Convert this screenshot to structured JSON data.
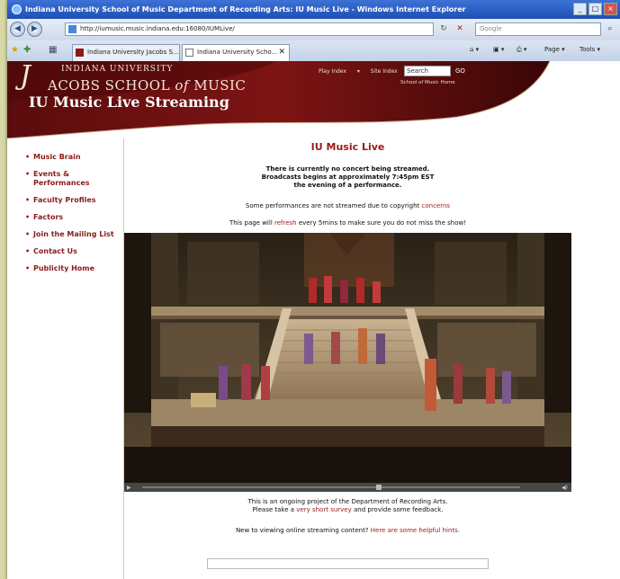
{
  "window": {
    "title": "Indiana University School of Music Department of Recording Arts: IU Music Live - Windows Internet Explorer",
    "url": "http://iumusic.music.indiana.edu:16080/IUMLive/",
    "search_placeholder": "Google"
  },
  "tabs": [
    {
      "label": "Indiana University Jacobs S..."
    },
    {
      "label": "Indiana University Scho..."
    }
  ],
  "commands": {
    "page": "Page",
    "tools": "Tools"
  },
  "banner": {
    "indiana": "INDIANA UNIVERSITY",
    "j": "J",
    "school_pre": "ACOBS SCHOOL ",
    "school_of": "of",
    "school_post": " MUSIC",
    "title": "IU Music Live Streaming",
    "nav": [
      "Play Index",
      "Site Index"
    ],
    "search_value": "Search",
    "go": "GO",
    "home_link": "School of Music Home"
  },
  "sidebar": {
    "items": [
      {
        "label": "Music Brain"
      },
      {
        "label": "Events & Performances"
      },
      {
        "label": "Faculty Profiles"
      },
      {
        "label": "Factors"
      },
      {
        "label": "Join the Mailing List"
      },
      {
        "label": "Contact Us"
      },
      {
        "label": "Publicity Home"
      }
    ]
  },
  "main": {
    "title": "IU Music Live",
    "status_line1": "There is currently no concert being streamed.",
    "status_line2": "Broadcasts begins at approximately 7:45pm EST",
    "status_line3": "the evening of a performance.",
    "copyright_pre": "Some performances are not streamed due to copyright ",
    "copyright_link": "concerns",
    "refresh_pre": "This page will ",
    "refresh_link": "refresh",
    "refresh_post": " every 5mins to make sure you do not miss the show!",
    "project_line": "This is an ongoing project of the Department of Recording Arts.",
    "survey_pre": "Please take a ",
    "survey_link": "very short survey",
    "survey_post": " and provide some feedback.",
    "help_pre": "New to viewing online streaming content? ",
    "help_link": "Here are some helpful hints."
  }
}
